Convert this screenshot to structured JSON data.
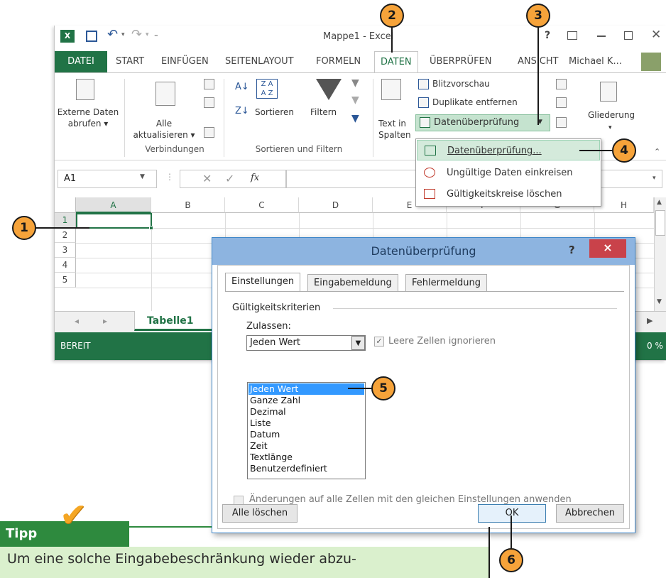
{
  "excel": {
    "title": "Mappe1 - Excel",
    "user": "Michael K...",
    "tabs": [
      "DATEI",
      "START",
      "EINFÜGEN",
      "SEITENLAYOUT",
      "FORMELN",
      "DATEN",
      "ÜBERPRÜFEN",
      "ANSICHT"
    ],
    "ribbon": {
      "externe_daten": [
        "Externe Daten",
        "abrufen ▾"
      ],
      "alle_aktualisieren": [
        "Alle",
        "aktualisieren ▾"
      ],
      "sortieren": "Sortieren",
      "filtern": "Filtern",
      "text_in_spalten": [
        "Text in",
        "Spalten"
      ],
      "blitzvorschau": "Blitzvorschau",
      "duplikate": "Duplikate entfernen",
      "datenueberpruefung": "Datenüberprüfung",
      "gliederung": "Gliederung",
      "groups": [
        "Verbindungen",
        "Sortieren und Filtern"
      ]
    },
    "namebox": "A1",
    "fx": "fx",
    "columns": [
      "A",
      "B",
      "C",
      "D",
      "E",
      "F",
      "G",
      "H"
    ],
    "rows": [
      "1",
      "2",
      "3",
      "4",
      "5"
    ],
    "sheet_tab": "Tabelle1",
    "status": "BEREIT",
    "zoom_fragment": "0 %"
  },
  "menu": {
    "items": [
      "Datenüberprüfung...",
      "Ungültige Daten einkreisen",
      "Gültigkeitskreise löschen"
    ]
  },
  "dialog": {
    "title": "Datenüberprüfung",
    "help": "?",
    "close": "×",
    "tabs": [
      "Einstellungen",
      "Eingabemeldung",
      "Fehlermeldung"
    ],
    "group_label": "Gültigkeitskriterien",
    "zulassen_label": "Zulassen:",
    "zulassen_value": "Jeden Wert",
    "ignore_blank": "Leere Zellen ignorieren",
    "ignore_blank_checked": true,
    "options": [
      "Jeden Wert",
      "Ganze Zahl",
      "Dezimal",
      "Liste",
      "Datum",
      "Zeit",
      "Textlänge",
      "Benutzerdefiniert"
    ],
    "apply_all": "Änderungen auf alle Zellen mit den gleichen Einstellungen anwenden",
    "btn_clear": "Alle löschen",
    "btn_ok": "OK",
    "btn_cancel": "Abbrechen"
  },
  "callouts": [
    "1",
    "2",
    "3",
    "4",
    "5",
    "6"
  ],
  "tip": {
    "label": "Tipp",
    "text": "Um eine solche Eingabebeschränkung wieder abzu-"
  },
  "colors": {
    "excel_green": "#217346",
    "callout_orange": "#f6a33a",
    "tip_green": "#2e8a3e",
    "tip_bg": "#daf0cd"
  }
}
